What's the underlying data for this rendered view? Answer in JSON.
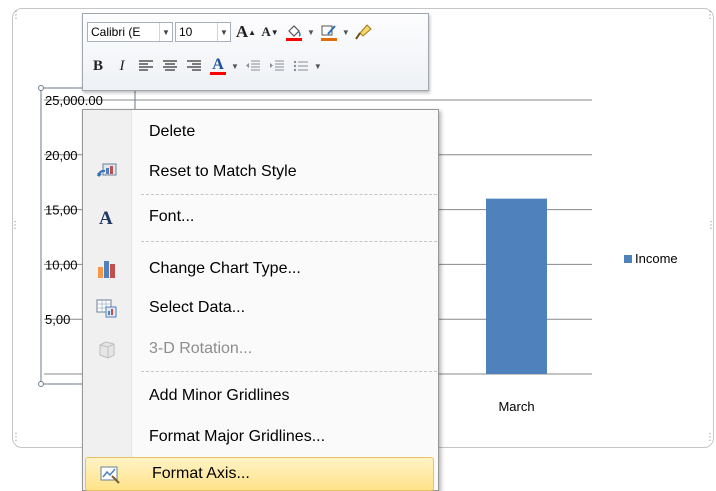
{
  "mini_toolbar": {
    "font_name": "Calibri (E",
    "font_size": "10",
    "grow_font": "A",
    "shrink_font": "A",
    "bold": "B",
    "italic": "I",
    "font_color_letter": "A"
  },
  "context_menu": {
    "items": [
      {
        "label": "Delete",
        "enabled": true,
        "icon": "none"
      },
      {
        "label": "Reset to Match Style",
        "enabled": true,
        "icon": "reset-style-icon"
      },
      {
        "label": "Font...",
        "enabled": true,
        "icon": "font-icon"
      },
      {
        "label": "Change Chart Type...",
        "enabled": true,
        "icon": "chart-type-icon"
      },
      {
        "label": "Select Data...",
        "enabled": true,
        "icon": "select-data-icon"
      },
      {
        "label": "3-D Rotation...",
        "enabled": false,
        "icon": "3d-rotation-icon"
      },
      {
        "label": "Add Minor Gridlines",
        "enabled": true,
        "icon": "none"
      },
      {
        "label": "Format Major Gridlines...",
        "enabled": true,
        "icon": "none"
      },
      {
        "label": "Format Axis...",
        "enabled": true,
        "icon": "format-axis-icon",
        "highlighted": true
      }
    ]
  },
  "chart_data": {
    "type": "bar",
    "categories": [
      "March"
    ],
    "series": [
      {
        "name": "Income",
        "values": [
          16000
        ]
      }
    ],
    "yticks": [
      "25,000.00",
      "20,00",
      "15,00",
      "10,00",
      "5,00"
    ],
    "ylim": [
      0,
      25000
    ],
    "grid": true,
    "legend": "right",
    "bar_color": "#4f81bd"
  }
}
